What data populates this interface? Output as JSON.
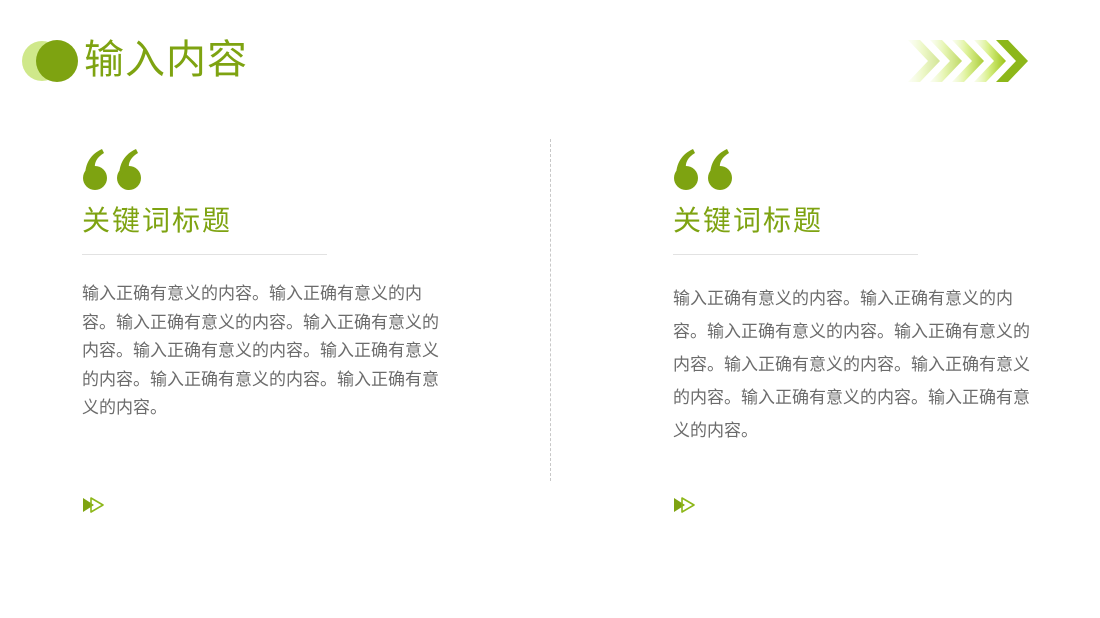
{
  "header": {
    "title": "输入内容",
    "icons": [
      "title-dots-icon",
      "chevron-arrows-icon"
    ]
  },
  "cards": [
    {
      "icon": "quote-icon",
      "title": "关键词标题",
      "body": "输入正确有意义的内容。输入正确有意义的内容。输入正确有意义的内容。输入正确有意义的内容。输入正确有意义的内容。输入正确有意义的内容。输入正确有意义的内容。输入正确有意义的内容。",
      "footer_icon": "play-arrow-icon"
    },
    {
      "icon": "quote-icon",
      "title": "关键词标题",
      "body": "输入正确有意义的内容。输入正确有意义的内容。输入正确有意义的内容。输入正确有意义的内容。输入正确有意义的内容。输入正确有意义的内容。输入正确有意义的内容。输入正确有意义的内容。",
      "footer_icon": "play-arrow-icon"
    }
  ],
  "colors": {
    "accent": "#7ea311",
    "accent_light": "#cfe88a",
    "body_text": "#6b6b6b",
    "rule": "#e2e2e2"
  }
}
